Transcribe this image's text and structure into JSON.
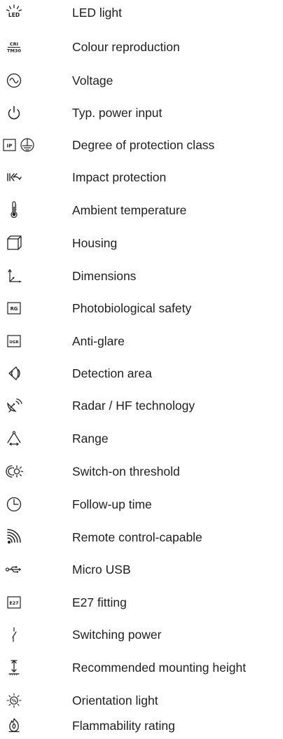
{
  "legend": {
    "items": [
      {
        "icon": "led-light-icon",
        "label": "LED light",
        "icon_text": "LED"
      },
      {
        "icon": "colour-reproduction-icon",
        "label": "Colour reproduction",
        "icon_text_top": "CRI",
        "icon_text_bottom": "TM30"
      },
      {
        "icon": "voltage-icon",
        "label": "Voltage"
      },
      {
        "icon": "power-icon",
        "label": "Typ. power input"
      },
      {
        "icon": "protection-class-icon",
        "label": "Degree of protection class",
        "icon_text": "IP"
      },
      {
        "icon": "impact-protection-icon",
        "label": "Impact protection"
      },
      {
        "icon": "thermometer-icon",
        "label": "Ambient temperature"
      },
      {
        "icon": "housing-icon",
        "label": "Housing"
      },
      {
        "icon": "dimensions-icon",
        "label": "Dimensions"
      },
      {
        "icon": "photobiological-safety-icon",
        "label": "Photobiological safety",
        "icon_text": "RG"
      },
      {
        "icon": "anti-glare-icon",
        "label": "Anti-glare",
        "icon_text": "UGR"
      },
      {
        "icon": "detection-area-icon",
        "label": "Detection area"
      },
      {
        "icon": "radar-hf-icon",
        "label": "Radar / HF technology"
      },
      {
        "icon": "range-icon",
        "label": "Range"
      },
      {
        "icon": "switch-on-threshold-icon",
        "label": "Switch-on threshold"
      },
      {
        "icon": "clock-icon",
        "label": "Follow-up time"
      },
      {
        "icon": "remote-control-icon",
        "label": "Remote control-capable"
      },
      {
        "icon": "usb-icon",
        "label": "Micro USB"
      },
      {
        "icon": "e27-fitting-icon",
        "label": "E27 fitting",
        "icon_text": "E27"
      },
      {
        "icon": "switch-icon",
        "label": "Switching power"
      },
      {
        "icon": "mounting-height-icon",
        "label": "Recommended mounting height"
      },
      {
        "icon": "orientation-light-icon",
        "label": "Orientation light",
        "icon_text": "%"
      },
      {
        "icon": "flammability-icon",
        "label": "Flammability rating"
      }
    ]
  }
}
